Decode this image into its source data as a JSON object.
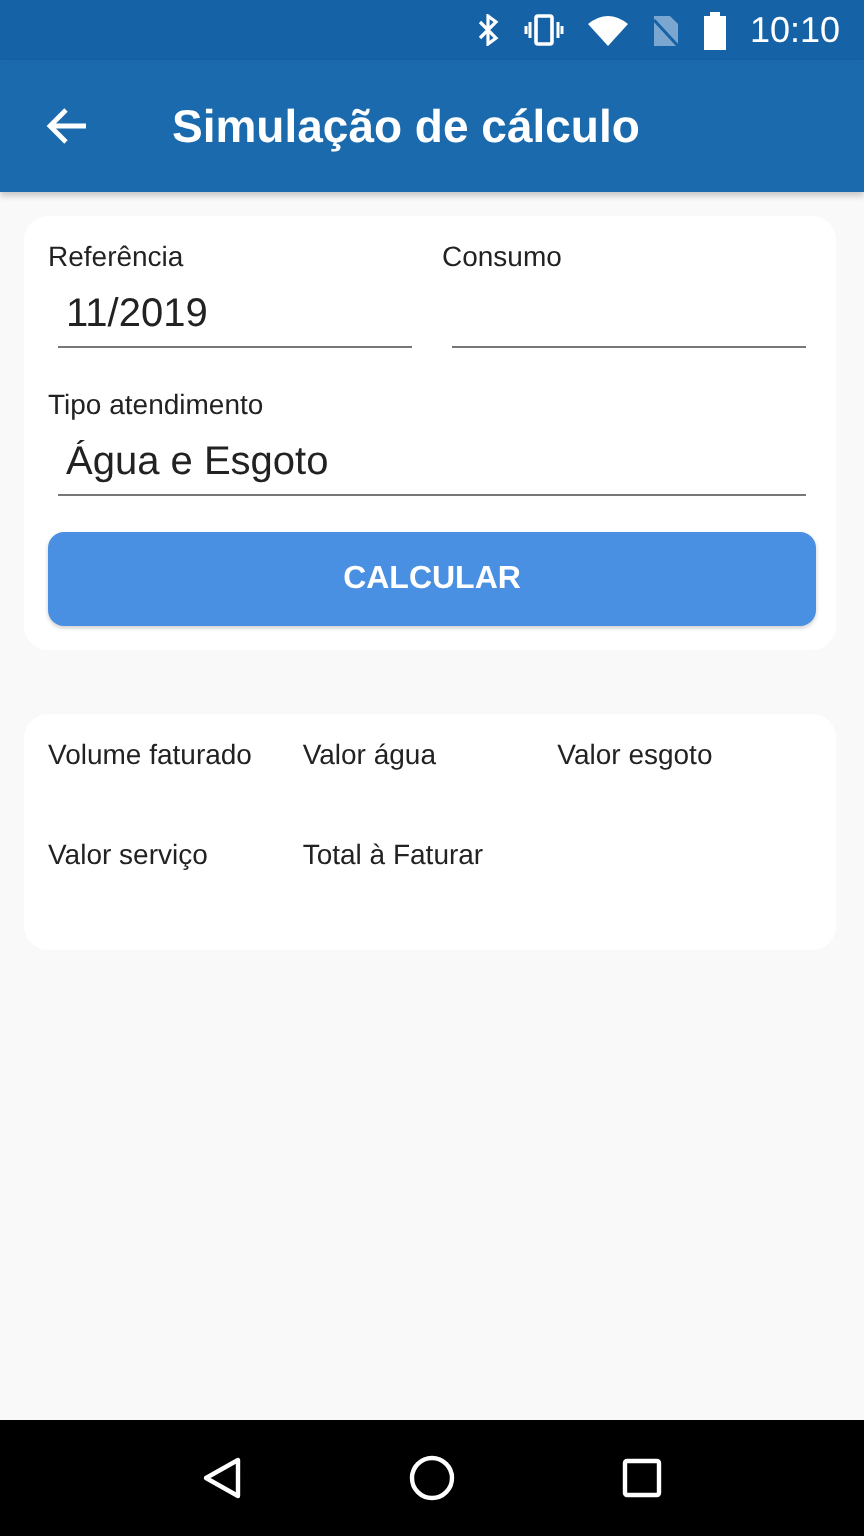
{
  "status_bar": {
    "time": "10:10"
  },
  "app_bar": {
    "title": "Simulação de cálculo"
  },
  "form": {
    "fields": [
      {
        "label": "Referência",
        "value": "11/2019"
      },
      {
        "label": "Consumo"
      },
      {
        "label": "Tipo atendimento",
        "value": "Água e Esgoto"
      }
    ],
    "button": "CALCULAR"
  },
  "results": {
    "labels": [
      "Volume faturado",
      "Valor água",
      "Valor esgoto",
      "Valor serviço",
      "Total à Faturar"
    ]
  }
}
